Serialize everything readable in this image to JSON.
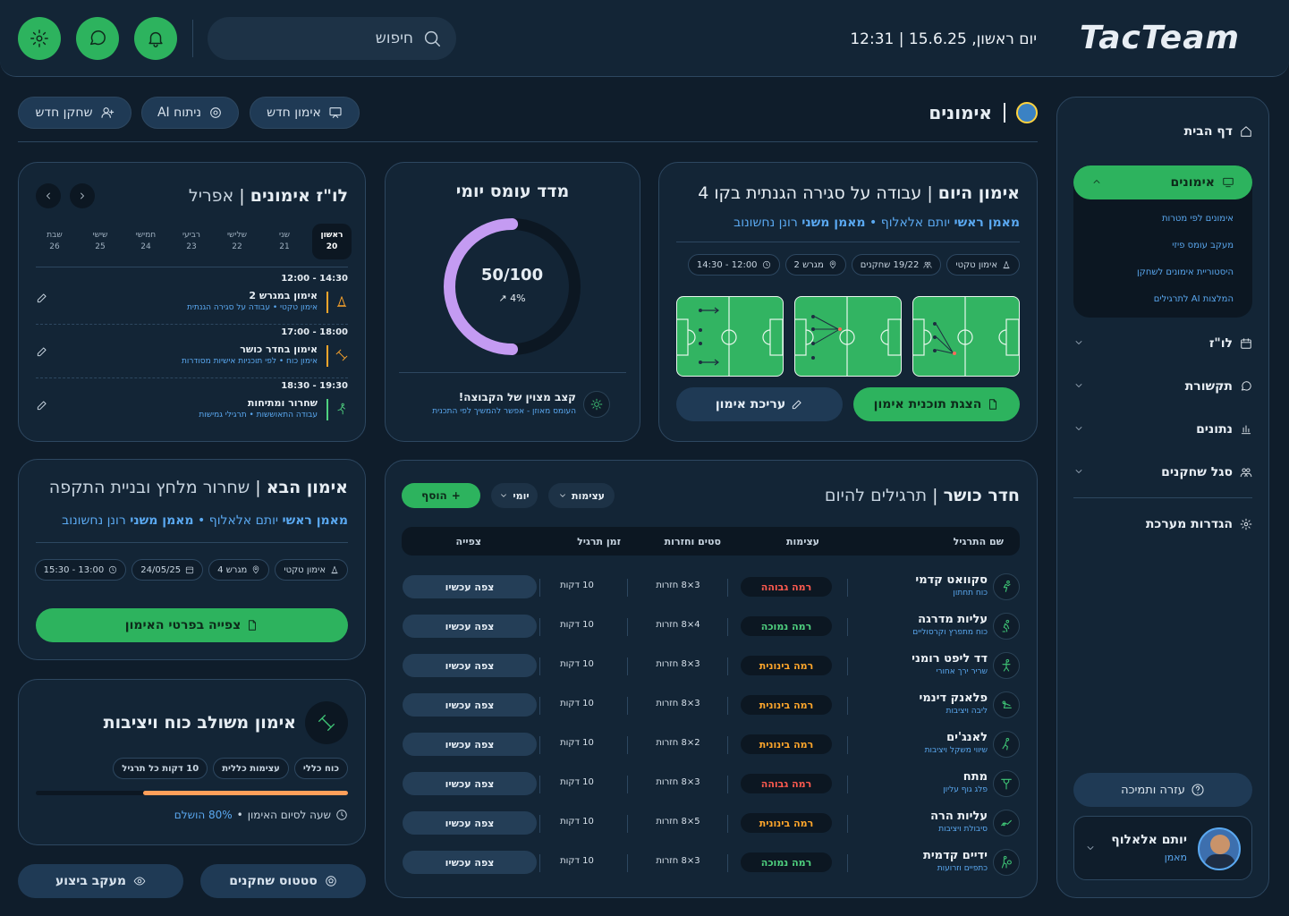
{
  "app": {
    "logo": "TacTeam",
    "datetime": "יום ראשון, 15.6.25 | 12:31",
    "search_placeholder": "חיפוש"
  },
  "colors": {
    "brand_green": "#2db35e",
    "background": "#0f1d2b",
    "card": "#132536",
    "accent_blue": "#5aa8f0",
    "high": "#ff5a4f",
    "medium": "#ffa62b",
    "low": "#4fd17f",
    "purple": "#c49bf2"
  },
  "page": {
    "title": "אימונים"
  },
  "actions": {
    "new_training": "אימון חדש",
    "ai_analysis": "ניתוח AI",
    "new_player": "שחקן חדש"
  },
  "sidebar": {
    "home": "דף הבית",
    "trainings": "אימונים",
    "sub_items": [
      "אימונים לפי מטרות",
      "מעקב עומס פיזי",
      "היסטוריית אימונים לשחקן",
      "המלצות AI לתרגילים"
    ],
    "schedule": "לו\"ז",
    "communication": "תקשורת",
    "data": "נתונים",
    "staff": "סגל שחקנים",
    "settings": "הגדרות מערכת",
    "help": "עזרה ותמיכה",
    "user_name": "יותם אלאלוף",
    "user_role": "מאמן"
  },
  "today": {
    "label": "אימון היום",
    "topic": "עבודה על סגירה הגנתית בקו 4",
    "head_coach_label": "מאמן ראשי",
    "head_coach": "יותם אלאלוף",
    "assistant_label": "מאמן משני",
    "assistant": "רונן נחשונוב",
    "chips": [
      "אימון טקטי",
      "19/22 שחקנים",
      "מגרש 2",
      "12:00 - 14:30"
    ],
    "view_plan": "הצגת תוכנית אימון",
    "edit": "עריכת אימון"
  },
  "load": {
    "title": "מדד עומס יומי",
    "value": "50/100",
    "change": "4%",
    "progress": 0.5,
    "note_title": "קצב מצוין של הקבוצה!",
    "note_text": "העומס מאוזן - אפשר להמשיך לפי התכנית"
  },
  "schedule": {
    "title": "לו\"ז אימונים",
    "month": "אפריל",
    "days": [
      {
        "name": "ראשון",
        "num": "20"
      },
      {
        "name": "שני",
        "num": "21"
      },
      {
        "name": "שלישי",
        "num": "22"
      },
      {
        "name": "רביעי",
        "num": "23"
      },
      {
        "name": "חמישי",
        "num": "24"
      },
      {
        "name": "שישי",
        "num": "25"
      },
      {
        "name": "שבת",
        "num": "26"
      }
    ],
    "items": [
      {
        "time": "12:00 - 14:30",
        "title": "אימון במגרש 2",
        "type": "אימון טקטי",
        "desc": "עבודה על סגירה הגנתית"
      },
      {
        "time": "17:00 - 18:00",
        "title": "אימון בחדר כושר",
        "type": "אימון כוח",
        "desc": "לפי תוכניות אישיות מסודרות"
      },
      {
        "time": "18:30 - 19:30",
        "title": "שחרור ומתיחות",
        "type": "עבודה התאוששות",
        "desc": "תרגילי גמישות"
      }
    ]
  },
  "next": {
    "label": "אימון הבא",
    "topic": "שחרור מלחץ ובניית התקפה",
    "head_coach_label": "מאמן ראשי",
    "head_coach": "יותם אלאלוף",
    "assistant_label": "מאמן משני",
    "assistant": "רונן נחשונוב",
    "chips": [
      "אימון טקטי",
      "מגרש 4",
      "24/05/25",
      "13:00 - 15:30"
    ],
    "watch": "צפייה בפרטי האימון"
  },
  "combined": {
    "title": "אימון משולב כוח ויציבות",
    "tags": [
      "כוח כללי",
      "עצימות כללית",
      "10 דקות כל תרגיל"
    ],
    "progress": 0.8,
    "progress_label": "שעה לסיום האימון",
    "percent": "80% הושלם"
  },
  "footer_buttons": {
    "player_status": "סטטוס שחקנים",
    "performance": "מעקב ביצוע"
  },
  "gym": {
    "label": "חדר כושר",
    "title": "תרגילים להיום",
    "filter_intensity": "עצימות",
    "filter_daily": "יומי",
    "add": "הוסף",
    "headers": [
      "שם התרגיל",
      "עצימות",
      "סטים וחזרות",
      "זמן תרגיל",
      "צפייה"
    ],
    "view_label": "צפה עכשיו",
    "rows": [
      {
        "name": "סקוואט קדמי",
        "sub": "כוח תחתון",
        "level": "רמה גבוהה",
        "level_color": "#ff5a4f",
        "sets": "3×8 חזרות",
        "time": "10 דקות"
      },
      {
        "name": "עליות מדרגה",
        "sub": "כוח מתפרץ וקרסוליים",
        "level": "רמה נמוכה",
        "level_color": "#4fd17f",
        "sets": "4×8 חזרות",
        "time": "10 דקות"
      },
      {
        "name": "דד ליפט רומני",
        "sub": "שריר ירך אחורי",
        "level": "רמה בינונית",
        "level_color": "#ffa62b",
        "sets": "3×8 חזרות",
        "time": "10 דקות"
      },
      {
        "name": "פלאנק דינמי",
        "sub": "ליבה ויציבות",
        "level": "רמה בינונית",
        "level_color": "#ffa62b",
        "sets": "3×8 חזרות",
        "time": "10 דקות"
      },
      {
        "name": "לאנג'ים",
        "sub": "שיווי משקל ויציבות",
        "level": "רמה בינונית",
        "level_color": "#ffa62b",
        "sets": "2×8 חזרות",
        "time": "10 דקות"
      },
      {
        "name": "מתח",
        "sub": "פלג גוף עליון",
        "level": "רמה גבוהה",
        "level_color": "#ff5a4f",
        "sets": "3×8 חזרות",
        "time": "10 דקות"
      },
      {
        "name": "עליות הרה",
        "sub": "סיבולת ויציבות",
        "level": "רמה בינונית",
        "level_color": "#ffa62b",
        "sets": "5×8 חזרות",
        "time": "10 דקות"
      },
      {
        "name": "ידיים קדמית",
        "sub": "כתפיים וזרועות",
        "level": "רמה נמוכה",
        "level_color": "#4fd17f",
        "sets": "3×8 חזרות",
        "time": "10 דקות"
      }
    ]
  }
}
